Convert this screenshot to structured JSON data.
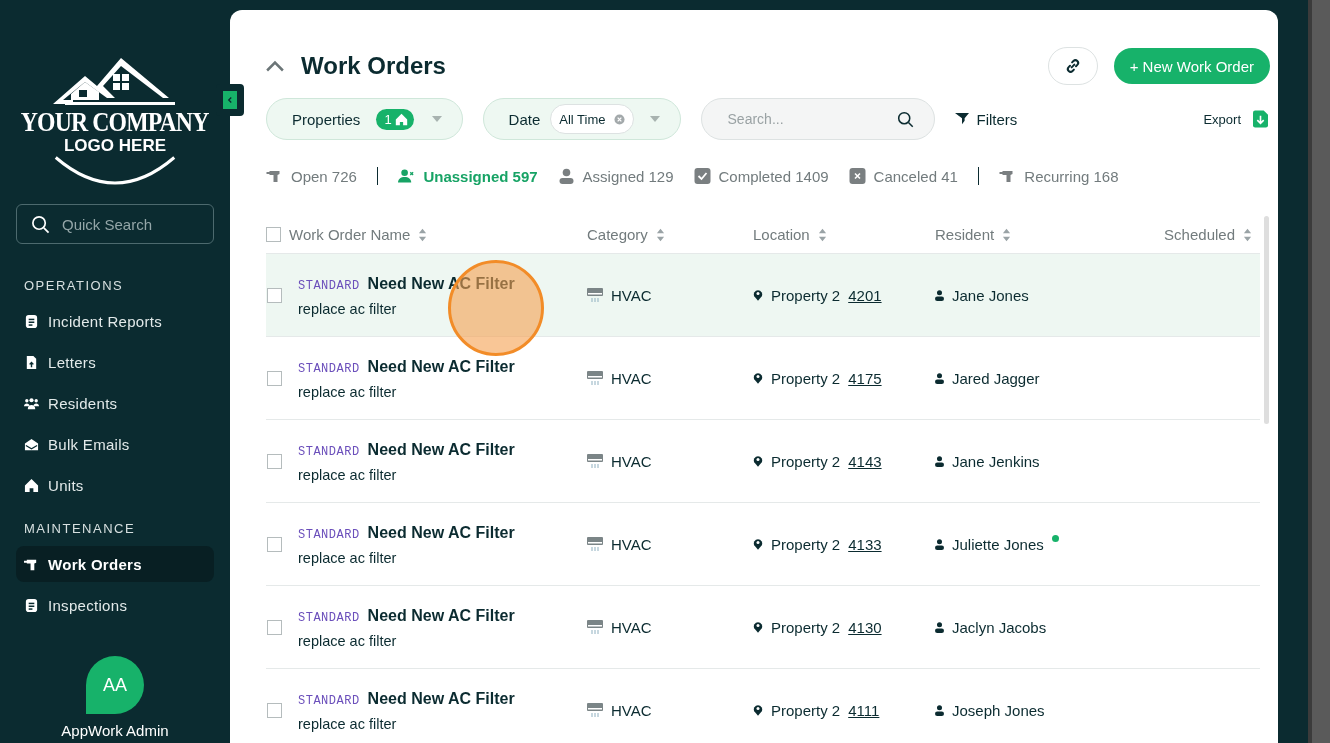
{
  "sidebar": {
    "logo": {
      "line1": "YOUR COMPANY",
      "line2": "LOGO HERE"
    },
    "search": {
      "placeholder": "Quick Search"
    },
    "sections": [
      {
        "heading": "OPERATIONS",
        "items": [
          {
            "label": "Incident Reports",
            "selected": false
          },
          {
            "label": "Letters",
            "selected": false
          },
          {
            "label": "Residents",
            "selected": false
          },
          {
            "label": "Bulk Emails",
            "selected": false
          },
          {
            "label": "Units",
            "selected": false
          }
        ]
      },
      {
        "heading": "MAINTENANCE",
        "items": [
          {
            "label": "Work Orders",
            "selected": true
          },
          {
            "label": "Inspections",
            "selected": false
          }
        ]
      }
    ],
    "user": {
      "initials": "AA",
      "name": "AppWork Admin"
    }
  },
  "page": {
    "title": "Work Orders",
    "new_button": "+ New Work Order",
    "filters": {
      "properties": {
        "label": "Properties",
        "count": "1"
      },
      "date": {
        "label": "Date",
        "value": "All Time"
      },
      "search": {
        "placeholder": "Search..."
      },
      "filters_button": "Filters",
      "export_button": "Export"
    },
    "status_tabs": [
      {
        "label": "Open 726",
        "selected": false
      },
      {
        "label": "Unassigned 597",
        "selected": true
      },
      {
        "label": "Assigned 129",
        "selected": false
      },
      {
        "label": "Completed 1409",
        "selected": false
      },
      {
        "label": "Canceled 41",
        "selected": false
      },
      {
        "label": "Recurring 168",
        "selected": false
      }
    ],
    "table": {
      "select_all_checked": false,
      "columns": [
        "Work Order Name",
        "Category",
        "Location",
        "Resident",
        "Scheduled"
      ],
      "rows": [
        {
          "type": "STANDARD",
          "name": "Need New AC Filter",
          "description": "replace ac filter",
          "category": "HVAC",
          "property": "Property 2",
          "unit": "4201",
          "resident": "Jane Jones",
          "online": false,
          "selected": true
        },
        {
          "type": "STANDARD",
          "name": "Need New AC Filter",
          "description": "replace ac filter",
          "category": "HVAC",
          "property": "Property 2",
          "unit": "4175",
          "resident": "Jared Jagger",
          "online": false,
          "selected": false
        },
        {
          "type": "STANDARD",
          "name": "Need New AC Filter",
          "description": "replace ac filter",
          "category": "HVAC",
          "property": "Property 2",
          "unit": "4143",
          "resident": "Jane Jenkins",
          "online": false,
          "selected": false
        },
        {
          "type": "STANDARD",
          "name": "Need New AC Filter",
          "description": "replace ac filter",
          "category": "HVAC",
          "property": "Property 2",
          "unit": "4133",
          "resident": "Juliette Jones",
          "online": true,
          "selected": false
        },
        {
          "type": "STANDARD",
          "name": "Need New AC Filter",
          "description": "replace ac filter",
          "category": "HVAC",
          "property": "Property 2",
          "unit": "4130",
          "resident": "Jaclyn Jacobs",
          "online": false,
          "selected": false
        },
        {
          "type": "STANDARD",
          "name": "Need New AC Filter",
          "description": "replace ac filter",
          "category": "HVAC",
          "property": "Property 2",
          "unit": "4111",
          "resident": "Joseph Jones",
          "online": false,
          "selected": false
        }
      ]
    }
  }
}
